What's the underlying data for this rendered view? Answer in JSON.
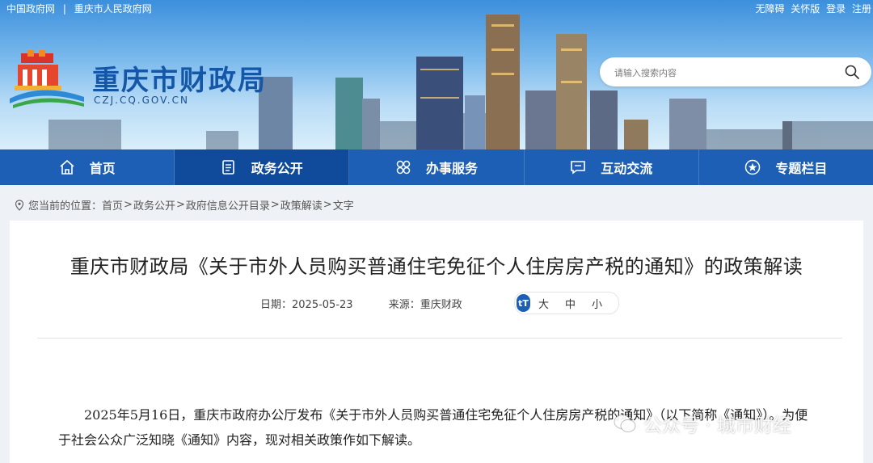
{
  "top_links": [
    "中国政府网",
    "|",
    "重庆市人民政府网"
  ],
  "top_right": [
    "无障碍",
    "关怀版",
    "登录",
    "注册"
  ],
  "site": {
    "name": "重庆市财政局",
    "domain": "CZJ.CQ.GOV.CN"
  },
  "search": {
    "placeholder": "请输入搜索内容"
  },
  "nav": [
    {
      "label": "首页",
      "icon": "home-icon"
    },
    {
      "label": "政务公开",
      "icon": "document-icon",
      "active": true
    },
    {
      "label": "办事服务",
      "icon": "grid-icon"
    },
    {
      "label": "互动交流",
      "icon": "chat-icon"
    },
    {
      "label": "专题栏目",
      "icon": "star-icon"
    }
  ],
  "breadcrumb": {
    "prefix": "您当前的位置：",
    "items": [
      "首页",
      "政务公开",
      "政府信息公开目录",
      "政策解读",
      "文字"
    ],
    "separator": ">"
  },
  "article": {
    "title": "重庆市财政局《关于市外人员购买普通住宅免征个人住房房产税的通知》的政策解读",
    "date": "日期：2025-05-23",
    "source": "来源：重庆财政",
    "font_sizes": [
      "大",
      "中",
      "小"
    ],
    "font_icon": "tT",
    "paragraph": "2025年5月16日，重庆市政府办公厅发布《关于市外人员购买普通住宅免征个人住房房产税的通知》（以下简称《通知》）。为便于社会公众广泛知晓《通知》内容，现对相关政策作如下解读。"
  },
  "watermark": "公众号 · 城市财经",
  "colors": {
    "nav": "#1c5fb4",
    "nav_active": "#0f4a9b",
    "brand": "#1457a8"
  }
}
